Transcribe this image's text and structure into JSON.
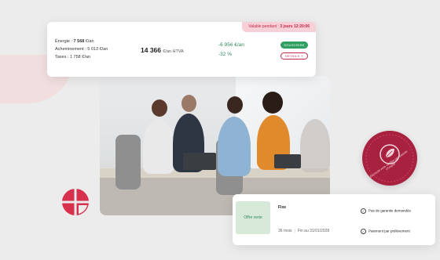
{
  "quote": {
    "validity_prefix": "Valable pendant :",
    "validity_value": "3 jours 12:20:06",
    "breakdown": [
      {
        "label": "Énergie :",
        "value": "7 568",
        "unit": "€/an"
      },
      {
        "label": "Acheminement :",
        "value": "5 013",
        "unit": "€/an"
      },
      {
        "label": "Taxes :",
        "value": "1 758",
        "unit": "€/an"
      }
    ],
    "total_value": "14 366",
    "total_unit": "€/an HTVA",
    "savings_amount": "-6 956 €/an",
    "savings_percent": "-32 %",
    "subscribe_label": "SOUSCRIRE",
    "details_label": "DÉTAILS"
  },
  "seal": {
    "text": "Électricité verte certifiée par Garantie d'Origine"
  },
  "offer": {
    "badge_label": "Offre verte",
    "title": "Fixe",
    "duration": "36 mois",
    "end_date": "Fin au 31/01/2028",
    "features": [
      "Pas de garantie demandée",
      "Paiement par prélèvement"
    ]
  },
  "colors": {
    "brand_red": "#c2264a",
    "green": "#2f9e61",
    "seal": "#a8213f",
    "offer_badge_bg": "#d7ead9"
  },
  "icons": {
    "logo": "brand-logo-icon",
    "seal": "leaf-seal-icon",
    "feature": "check-circle-icon",
    "details": "chevron-down-icon"
  }
}
